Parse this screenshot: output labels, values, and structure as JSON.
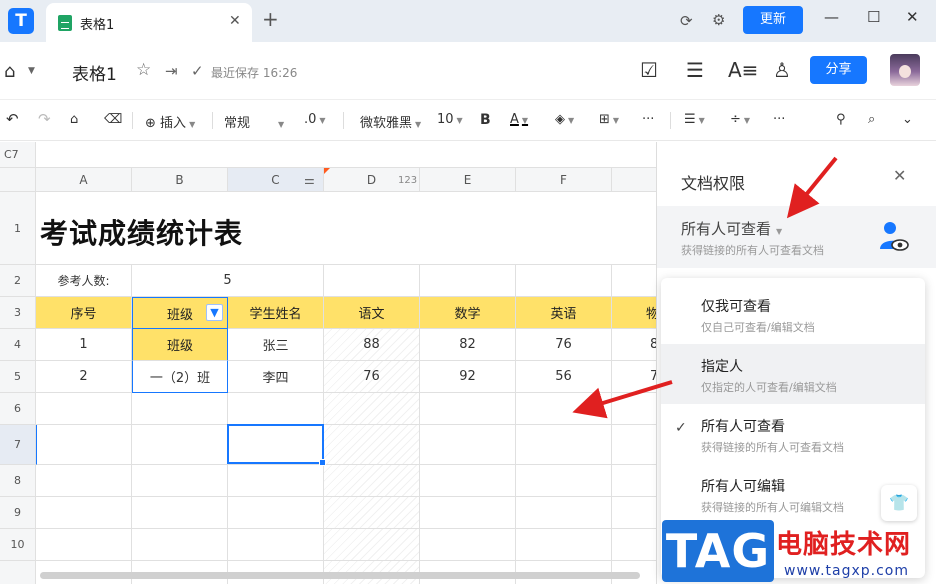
{
  "titlebar": {
    "logo_glyph": "T",
    "tab_label": "表格1",
    "tab_close": "✕",
    "new_tab": "+",
    "update_label": "更新",
    "win_min": "—",
    "win_max": "☐",
    "win_close": "✕"
  },
  "header": {
    "doc_title": "表格1",
    "save_status": "最近保存 16:26",
    "share_label": "分享"
  },
  "toolbar": {
    "insert_label": "插入",
    "format_label": "常规",
    "decimal_label": ".0",
    "font_label": "微软雅黑",
    "size_label": "10",
    "bold_label": "B",
    "textcolor_label": "A",
    "more1": "···",
    "more2": "···"
  },
  "sheet": {
    "cell_ref": "C7",
    "columns": [
      "A",
      "B",
      "C",
      "D",
      "E",
      "F"
    ],
    "col_extra_d": "123",
    "rows": [
      "1",
      "2",
      "3",
      "4",
      "5",
      "6",
      "7",
      "8",
      "9",
      "10"
    ],
    "title": "考试成绩统计表",
    "participants_label": "参考人数:",
    "participants_value": "5",
    "headers": [
      "序号",
      "班级",
      "学生姓名",
      "语文",
      "数学",
      "英语",
      "物"
    ],
    "row4": [
      "1",
      "班级",
      "张三",
      "88",
      "82",
      "76",
      "8"
    ],
    "row5": [
      "2",
      "一（2）班",
      "李四",
      "76",
      "92",
      "56",
      "7"
    ]
  },
  "panel": {
    "title": "文档权限",
    "close": "✕",
    "current": "所有人可查看",
    "current_sub": "获得链接的所有人可查看文档",
    "options": [
      {
        "label": "仅我可查看",
        "sub": "仅自己可查看/编辑文档"
      },
      {
        "label": "指定人",
        "sub": "仅指定的人可查看/编辑文档"
      },
      {
        "label": "所有人可查看",
        "sub": "获得链接的所有人可查看文档"
      },
      {
        "label": "所有人可编辑",
        "sub": "获得链接的所有人可编辑文档"
      }
    ],
    "check": "✓"
  },
  "watermark": {
    "logo": "TAG",
    "text": "电脑技术网",
    "url": "www.tagxp.com"
  },
  "colors": {
    "accent": "#1677ff",
    "header_yellow": "#ffe169",
    "arrow": "#e02020"
  }
}
